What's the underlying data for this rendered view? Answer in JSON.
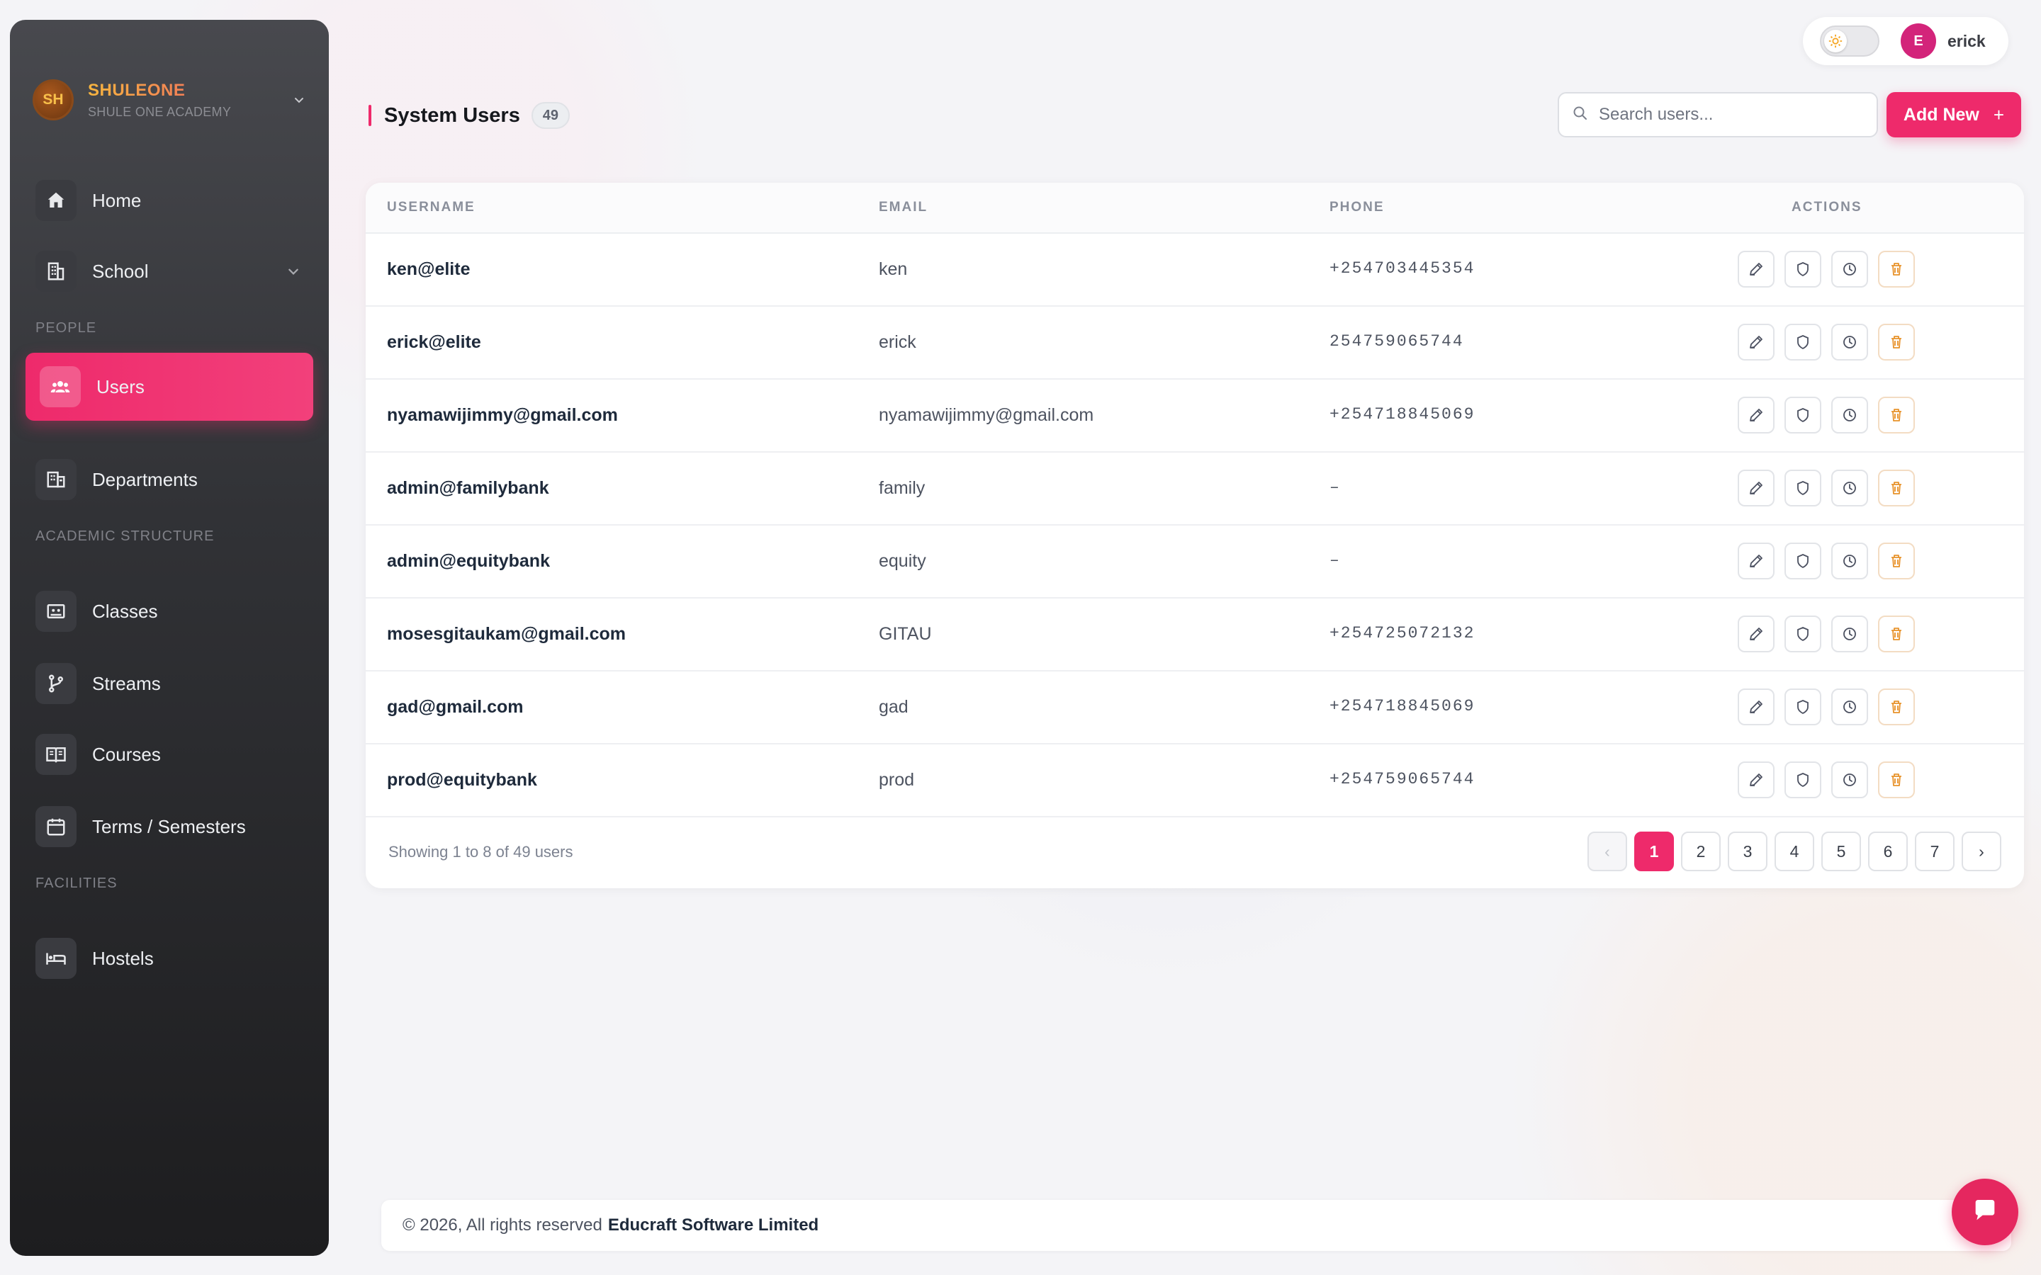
{
  "brand": {
    "initials": "SH",
    "name": "SHULEONE",
    "subtitle": "SHULE ONE ACADEMY"
  },
  "sidebar": {
    "items": [
      {
        "label": "Home",
        "icon": "home-icon"
      },
      {
        "label": "School",
        "icon": "building-icon"
      }
    ],
    "sections": [
      {
        "title": "PEOPLE",
        "items": [
          {
            "label": "Users",
            "icon": "users-icon",
            "active": true
          },
          {
            "label": "Departments",
            "icon": "departments-icon"
          }
        ]
      },
      {
        "title": "ACADEMIC STRUCTURE",
        "items": [
          {
            "label": "Classes",
            "icon": "classes-icon"
          },
          {
            "label": "Streams",
            "icon": "branch-icon"
          },
          {
            "label": "Courses",
            "icon": "book-icon"
          },
          {
            "label": "Terms / Semesters",
            "icon": "calendar-icon"
          }
        ]
      },
      {
        "title": "FACILITIES",
        "items": [
          {
            "label": "Hostels",
            "icon": "bed-icon"
          }
        ]
      }
    ]
  },
  "topbar": {
    "user_initial": "E",
    "user_name": "erick",
    "theme": "light"
  },
  "header": {
    "title": "System Users",
    "count": "49"
  },
  "search": {
    "placeholder": "Search users...",
    "value": ""
  },
  "add_button": {
    "label": "Add New",
    "icon": "+"
  },
  "table": {
    "columns": [
      "USERNAME",
      "EMAIL",
      "PHONE",
      "ACTIONS"
    ],
    "rows": [
      {
        "username": "ken@elite",
        "email": "ken",
        "phone": "+254703445354"
      },
      {
        "username": "erick@elite",
        "email": "erick",
        "phone": "254759065744"
      },
      {
        "username": "nyamawijimmy@gmail.com",
        "email": "nyamawijimmy@gmail.com",
        "phone": "+254718845069"
      },
      {
        "username": "admin@familybank",
        "email": "family",
        "phone": "–"
      },
      {
        "username": "admin@equitybank",
        "email": "equity",
        "phone": "–"
      },
      {
        "username": "mosesgitaukam@gmail.com",
        "email": "GITAU",
        "phone": "+254725072132"
      },
      {
        "username": "gad@gmail.com",
        "email": "gad",
        "phone": "+254718845069"
      },
      {
        "username": "prod@equitybank",
        "email": "prod",
        "phone": "+254759065744"
      }
    ],
    "actions": [
      "edit-icon",
      "shield-icon",
      "clock-icon",
      "trash-icon"
    ]
  },
  "pagination": {
    "summary": "Showing 1 to 8 of 49 users",
    "pages": [
      "1",
      "2",
      "3",
      "4",
      "5",
      "6",
      "7"
    ],
    "current": "1",
    "prev": "‹",
    "next": "›"
  },
  "footer": {
    "copyright": "© 2026, All rights reserved",
    "company": "Educraft Software Limited"
  },
  "colors": {
    "accent": "#ee2a6b",
    "sidebar_top": "#48494e",
    "sidebar_bottom": "#1d1d1f",
    "delete": "#e8922a"
  }
}
